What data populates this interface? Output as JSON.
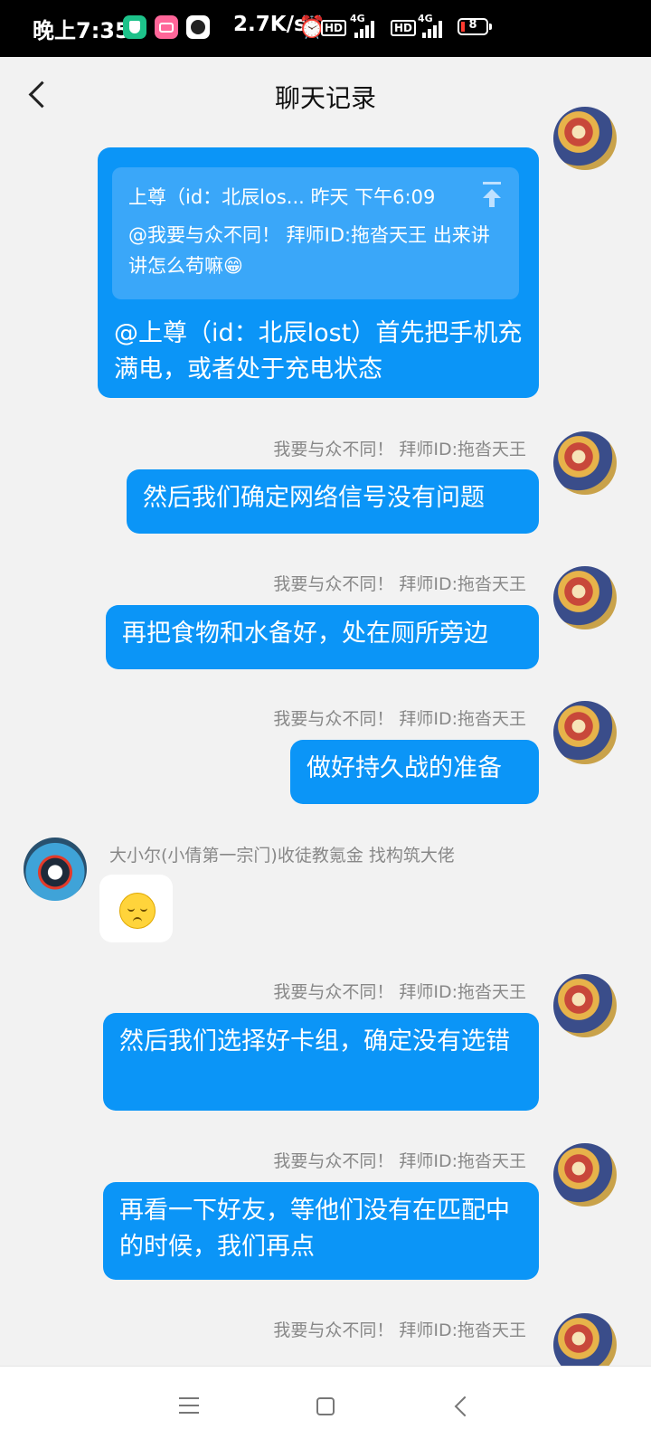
{
  "status": {
    "time": "晚上7:35",
    "speed": "2.7K/s",
    "hd1": "HD",
    "net1": "4G",
    "hd2": "HD",
    "net2": "4G",
    "battery": "8",
    "icons": [
      "shield-app-icon",
      "bilibili-app-icon",
      "circle-app-icon",
      "alarm-icon",
      "signal-icon",
      "battery-icon"
    ]
  },
  "header": {
    "title": "聊天记录"
  },
  "messages": [
    {
      "quote_head": "上尊（id：北辰los... 昨天 下午6:09",
      "quote_body": "@我要与众不同！  拜师ID:拖沓天王 出来讲讲怎么苟嘛😁",
      "text": "@上尊（id：北辰lost）首先把手机充满电，或者处于充电状态"
    },
    {
      "sender": "我要与众不同！  拜师ID:拖沓天王",
      "text": "然后我们确定网络信号没有问题"
    },
    {
      "sender": "我要与众不同！  拜师ID:拖沓天王",
      "text": "再把食物和水备好，处在厕所旁边"
    },
    {
      "sender": "我要与众不同！  拜师ID:拖沓天王",
      "text": "做好持久战的准备"
    },
    {
      "sender": "大小尔(小倩第一宗门)收徒教氪金 找构筑大佬",
      "emoji": "relieved-face-emoji"
    },
    {
      "sender": "我要与众不同！  拜师ID:拖沓天王",
      "text": "然后我们选择好卡组，确定没有选错"
    },
    {
      "sender": "我要与众不同！  拜师ID:拖沓天王",
      "text": "再看一下好友，等他们没有在匹配中的时候，我们再点"
    },
    {
      "sender": "我要与众不同！  拜师ID:拖沓天王"
    }
  ],
  "colors": {
    "bubble": "#0b95f7",
    "quote": "#3aa7f9",
    "background": "#f2f2f2"
  }
}
